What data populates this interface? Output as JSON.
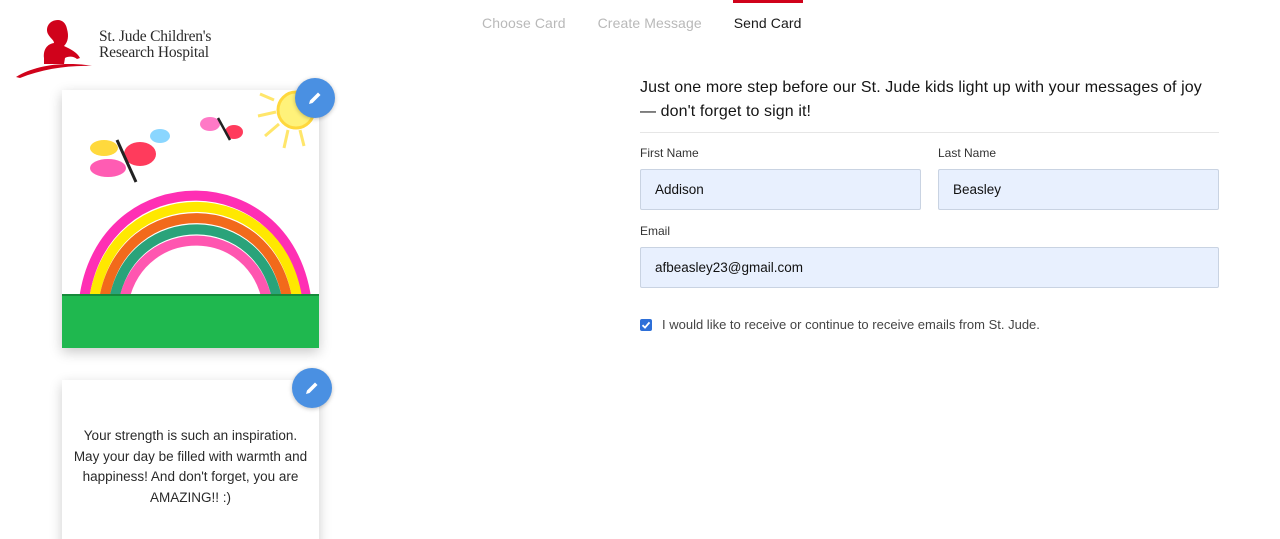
{
  "brand": {
    "name_line1": "St. Jude Children's",
    "name_line2": "Research Hospital",
    "accent_color": "#d0021b"
  },
  "steps": [
    {
      "label": "Choose Card",
      "state": "done"
    },
    {
      "label": "Create Message",
      "state": "done"
    },
    {
      "label": "Send Card",
      "state": "active"
    }
  ],
  "preview": {
    "card_edit_icon": "pencil-icon",
    "message": "Your strength is such an inspiration. May your day be filled with warmth and happiness! And don't forget, you are AMAZING!! :)",
    "message_edit_icon": "pencil-icon"
  },
  "form": {
    "title": "Just one more step before our St. Jude kids light up with your messages of joy — don't forget to sign it!",
    "first_name": {
      "label": "First Name",
      "value": "Addison"
    },
    "last_name": {
      "label": "Last Name",
      "value": "Beasley"
    },
    "email": {
      "label": "Email",
      "value": "afbeasley23@gmail.com"
    },
    "opt_in": {
      "label": "I would like to receive or continue to receive emails from St. Jude.",
      "checked": true
    }
  }
}
